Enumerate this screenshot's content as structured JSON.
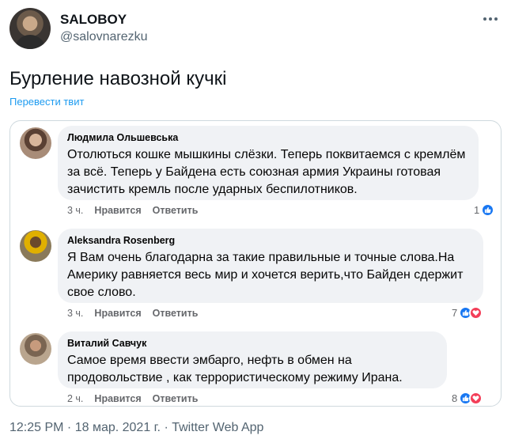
{
  "header": {
    "display_name": "SALOBOY",
    "handle": "@salovnarezku"
  },
  "tweet": {
    "text": "Бурление навозной кучкі",
    "translate_label": "Перевести твит"
  },
  "comments": [
    {
      "author": "Людмила Ольшевська",
      "text": "Отолються кошке мышкины слёзки. Теперь поквитаемся  с кремлём за всё. Теперь у Байдена есть союзная армия Украины готовая зачистить кремль после ударных беспилотников.",
      "time": "3 ч.",
      "like_label": "Нравится",
      "reply_label": "Ответить",
      "reaction_count": "1",
      "reactions": [
        "like-icon"
      ]
    },
    {
      "author": "Aleksandra Rosenberg",
      "text": "Я Вам очень благодарна за такие правильные и точные слова.На Америку равняется весь мир и хочется верить,что Байден сдержит свое слово.",
      "time": "3 ч.",
      "like_label": "Нравится",
      "reply_label": "Ответить",
      "reaction_count": "7",
      "reactions": [
        "like-icon",
        "love-icon"
      ]
    },
    {
      "author": "Виталий Савчук",
      "text": "Самое время ввести эмбарго, нефть в обмен на продовольствие , как террористическому режиму Ирана.",
      "time": "2 ч.",
      "like_label": "Нравится",
      "reply_label": "Ответить",
      "reaction_count": "8",
      "reactions": [
        "like-icon",
        "love-icon"
      ]
    }
  ],
  "footer": {
    "timestamp": "12:25 PM · 18 мар. 2021 г. · Twitter Web App"
  },
  "colors": {
    "link": "#1d9bf0",
    "bubble": "#f0f2f5",
    "like": "#1877f2",
    "love": "#f33e58"
  }
}
